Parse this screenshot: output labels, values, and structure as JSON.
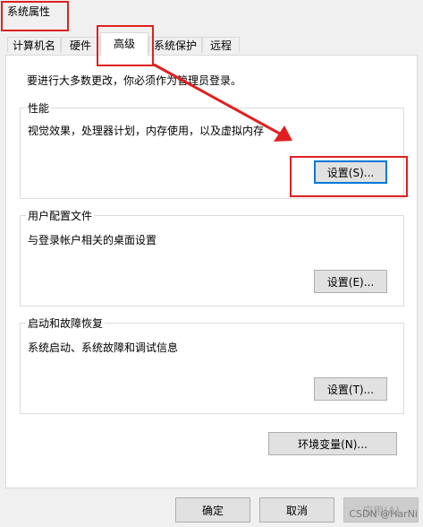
{
  "window": {
    "title": "系统属性"
  },
  "tabs": [
    {
      "label": "计算机名"
    },
    {
      "label": "硬件"
    },
    {
      "label": "高级"
    },
    {
      "label": "系统保护"
    },
    {
      "label": "远程"
    }
  ],
  "notice": "要进行大多数更改，你必须作为管理员登录。",
  "performance": {
    "label": "性能",
    "desc": "视觉效果，处理器计划，内存使用，以及虚拟内存",
    "button": "设置(S)..."
  },
  "profiles": {
    "label": "用户配置文件",
    "desc": "与登录帐户相关的桌面设置",
    "button": "设置(E)..."
  },
  "startup": {
    "label": "启动和故障恢复",
    "desc": "系统启动、系统故障和调试信息",
    "button": "设置(T)..."
  },
  "env_button": "环境变量(N)...",
  "footer": {
    "ok": "确定",
    "cancel": "取消",
    "apply": "应用(A)"
  },
  "watermark": "CSDN @HarNi",
  "colors": {
    "highlight": "#e02020",
    "focus": "#0078d7"
  }
}
